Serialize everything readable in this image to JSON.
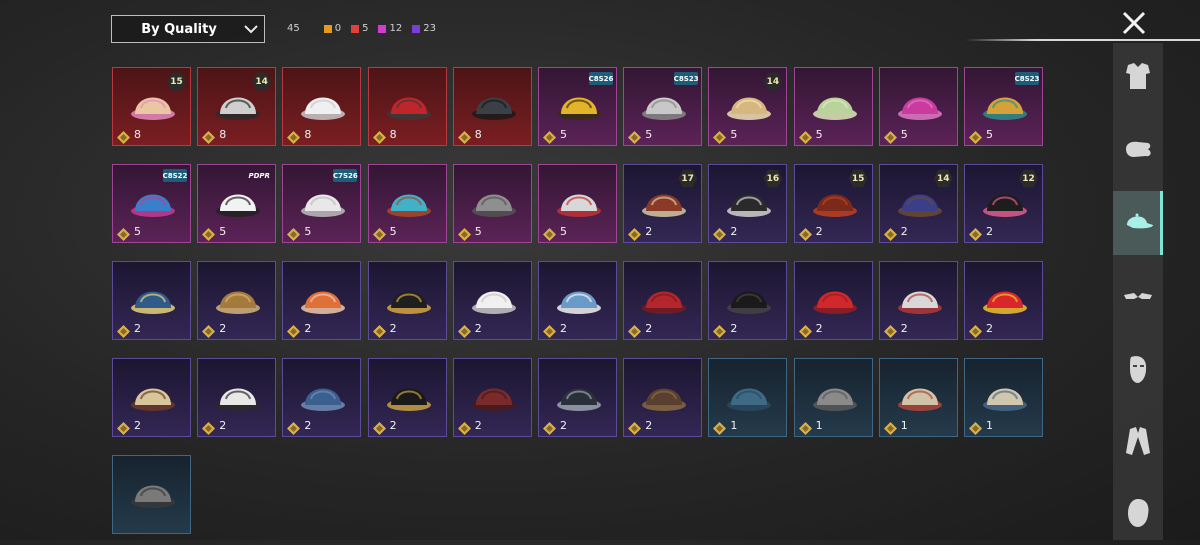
{
  "toolbar": {
    "sort_label": "By Quality",
    "total": "45",
    "counts": [
      {
        "color": "#e59a1e",
        "value": "0"
      },
      {
        "color": "#e0423a",
        "value": "5"
      },
      {
        "color": "#d53ad0",
        "value": "12"
      },
      {
        "color": "#7a3ed8",
        "value": "23"
      }
    ]
  },
  "sidebar": {
    "tabs": [
      {
        "name": "outfit-icon"
      },
      {
        "name": "glove-icon"
      },
      {
        "name": "cap-icon",
        "active": true
      },
      {
        "name": "goggles-icon"
      },
      {
        "name": "mask-icon"
      },
      {
        "name": "jacket-icon"
      },
      {
        "name": "face-icon"
      }
    ]
  },
  "items": [
    {
      "tier": "red",
      "qty": "8",
      "badge": "15",
      "art": "hair-pink-blonde"
    },
    {
      "tier": "red",
      "qty": "8",
      "badge": "14",
      "art": "cat-mask"
    },
    {
      "tier": "red",
      "qty": "8",
      "badge": "",
      "art": "white-cowboy-hat"
    },
    {
      "tier": "red",
      "qty": "8",
      "badge": "",
      "art": "red-helmet"
    },
    {
      "tier": "red",
      "qty": "8",
      "badge": "",
      "art": "dark-helmet"
    },
    {
      "tier": "pink",
      "qty": "5",
      "badge": "C8S26",
      "art": "yellow-creature-hat"
    },
    {
      "tier": "pink",
      "qty": "5",
      "badge": "C8S23",
      "art": "silver-hair"
    },
    {
      "tier": "pink",
      "qty": "5",
      "badge": "14",
      "art": "blonde-hair-star"
    },
    {
      "tier": "pink",
      "qty": "5",
      "badge": "",
      "art": "green-hair"
    },
    {
      "tier": "pink",
      "qty": "5",
      "badge": "",
      "art": "pink-twin-tails"
    },
    {
      "tier": "pink",
      "qty": "5",
      "badge": "C8S23",
      "art": "cat-headphones"
    },
    {
      "tier": "pink",
      "qty": "5",
      "badge": "C8S22",
      "art": "blue-pink-hair"
    },
    {
      "tier": "pink",
      "qty": "5",
      "badge": "PDPR",
      "art": "panda-head"
    },
    {
      "tier": "pink",
      "qty": "5",
      "badge": "C7S26",
      "art": "white-hair"
    },
    {
      "tier": "pink",
      "qty": "5",
      "badge": "",
      "art": "blue-monster-mask"
    },
    {
      "tier": "pink",
      "qty": "5",
      "badge": "",
      "art": "wolf-mask"
    },
    {
      "tier": "pink",
      "qty": "5",
      "badge": "",
      "art": "rooster-hood"
    },
    {
      "tier": "purple",
      "qty": "2",
      "badge": "17",
      "art": "viking-helmet"
    },
    {
      "tier": "purple",
      "qty": "2",
      "badge": "16",
      "art": "spiked-helmet"
    },
    {
      "tier": "purple",
      "qty": "2",
      "badge": "15",
      "art": "red-hood"
    },
    {
      "tier": "purple",
      "qty": "2",
      "badge": "14",
      "art": "police-cap-hair"
    },
    {
      "tier": "purple",
      "qty": "2",
      "badge": "12",
      "art": "bunny-ears"
    },
    {
      "tier": "purple",
      "qty": "2",
      "badge": "",
      "art": "blue-cap"
    },
    {
      "tier": "purple",
      "qty": "2",
      "badge": "",
      "art": "horned-hair"
    },
    {
      "tier": "purple",
      "qty": "2",
      "badge": "",
      "art": "fox-ears"
    },
    {
      "tier": "purple",
      "qty": "2",
      "badge": "",
      "art": "black-cap"
    },
    {
      "tier": "purple",
      "qty": "2",
      "badge": "",
      "art": "white-turban"
    },
    {
      "tier": "purple",
      "qty": "2",
      "badge": "",
      "art": "shark-hat"
    },
    {
      "tier": "purple",
      "qty": "2",
      "badge": "",
      "art": "red-beret"
    },
    {
      "tier": "purple",
      "qty": "2",
      "badge": "",
      "art": "black-fedora"
    },
    {
      "tier": "purple",
      "qty": "2",
      "badge": "",
      "art": "red-bucket-hat"
    },
    {
      "tier": "purple",
      "qty": "2",
      "badge": "",
      "art": "shark-head"
    },
    {
      "tier": "purple",
      "qty": "2",
      "badge": "",
      "art": "red-bucket-hat-2"
    },
    {
      "tier": "purple",
      "qty": "2",
      "badge": "",
      "art": "cake-hat"
    },
    {
      "tier": "purple",
      "qty": "2",
      "badge": "",
      "art": "head-mirror"
    },
    {
      "tier": "purple",
      "qty": "2",
      "badge": "",
      "art": "blue-cap-small"
    },
    {
      "tier": "purple",
      "qty": "2",
      "badge": "",
      "art": "black-baseball-cap"
    },
    {
      "tier": "purple",
      "qty": "2",
      "badge": "",
      "art": "brown-fedora"
    },
    {
      "tier": "purple",
      "qty": "2",
      "badge": "",
      "art": "camo-bucket-hat"
    },
    {
      "tier": "purple",
      "qty": "2",
      "badge": "",
      "art": "aviator-hat"
    },
    {
      "tier": "blue",
      "qty": "1",
      "badge": "",
      "art": "blue-beret"
    },
    {
      "tier": "blue",
      "qty": "1",
      "badge": "",
      "art": "grey-beret"
    },
    {
      "tier": "blue",
      "qty": "1",
      "badge": "",
      "art": "tan-cap"
    },
    {
      "tier": "blue",
      "qty": "1",
      "badge": "",
      "art": "tan-cap-2"
    },
    {
      "tier": "blue",
      "qty": "",
      "badge": "",
      "art": "camo-cap"
    }
  ],
  "art_colors": {
    "hair-pink-blonde": [
      "#e8c7a2",
      "#e78bc0"
    ],
    "cat-mask": [
      "#cfcfcf",
      "#2a2a2a"
    ],
    "white-cowboy-hat": [
      "#f0f0f0",
      "#c9c9c9"
    ],
    "red-helmet": [
      "#c0252b",
      "#3a3a3a"
    ],
    "dark-helmet": [
      "#3b3f46",
      "#1a1a1a"
    ],
    "yellow-creature-hat": [
      "#e3b329",
      "#3a2b10"
    ],
    "silver-hair": [
      "#c8c8c8",
      "#888888"
    ],
    "blonde-hair-star": [
      "#d6b77f",
      "#f1e2b5"
    ],
    "green-hair": [
      "#b8d39b",
      "#dfe9b9"
    ],
    "pink-twin-tails": [
      "#c93c9e",
      "#e17bc3"
    ],
    "cat-headphones": [
      "#d5a23a",
      "#2b8f8c"
    ],
    "blue-pink-hair": [
      "#3a7fc9",
      "#c43b94"
    ],
    "panda-head": [
      "#f2f2f2",
      "#222222"
    ],
    "white-hair": [
      "#e8e8e8",
      "#bdbdbd"
    ],
    "blue-monster-mask": [
      "#3fb2c9",
      "#a84a2a"
    ],
    "wolf-mask": [
      "#8f8f8f",
      "#555555"
    ],
    "rooster-hood": [
      "#d8d8d8",
      "#c23232"
    ],
    "viking-helmet": [
      "#8c3a28",
      "#d6c8a0"
    ],
    "spiked-helmet": [
      "#2a2a2a",
      "#d0d0d0"
    ],
    "red-hood": [
      "#7a2a1a",
      "#c04020"
    ],
    "police-cap-hair": [
      "#3b3f8a",
      "#6a4a30"
    ],
    "bunny-ears": [
      "#1d1d1d",
      "#e05a8c"
    ],
    "blue-cap": [
      "#2f5a8a",
      "#e6d27a"
    ],
    "horned-hair": [
      "#a57a3c",
      "#d6b47a"
    ],
    "fox-ears": [
      "#e0703a",
      "#f2c7a8"
    ],
    "black-cap": [
      "#1f1f1f",
      "#d6a542"
    ],
    "white-turban": [
      "#f0f0f0",
      "#c8c8c8"
    ],
    "shark-hat": [
      "#6a9ac7",
      "#f2f2f2"
    ],
    "red-beret": [
      "#b3262b",
      "#7a1a1e"
    ],
    "black-fedora": [
      "#1a1a1a",
      "#444444"
    ],
    "red-bucket-hat": [
      "#d0282c",
      "#9a1c20"
    ],
    "shark-head": [
      "#d8d8d8",
      "#b23a3a"
    ],
    "red-bucket-hat-2": [
      "#d8262a",
      "#f0c030"
    ],
    "cake-hat": [
      "#d9c59a",
      "#6a3a2a"
    ],
    "head-mirror": [
      "#e8e8e8",
      "#2a2a2a"
    ],
    "blue-cap-small": [
      "#3b5f8f",
      "#6f8fb8"
    ],
    "black-baseball-cap": [
      "#1a1a1a",
      "#c9a040"
    ],
    "brown-fedora": [
      "#7a2a2a",
      "#4a1a1a"
    ],
    "camo-bucket-hat": [
      "#2a2f3a",
      "#9aa3b0"
    ],
    "aviator-hat": [
      "#5a4030",
      "#8a6a40"
    ],
    "blue-beret": [
      "#3f6a86",
      "#2a4a60"
    ],
    "grey-beret": [
      "#8a8a8a",
      "#5a5a5a"
    ],
    "tan-cap": [
      "#cfc4a8",
      "#b0443a"
    ],
    "tan-cap-2": [
      "#d0c7ad",
      "#4a6a8a"
    ],
    "camo-cap": [
      "#7a7a7a",
      "#3a3a3a"
    ]
  }
}
